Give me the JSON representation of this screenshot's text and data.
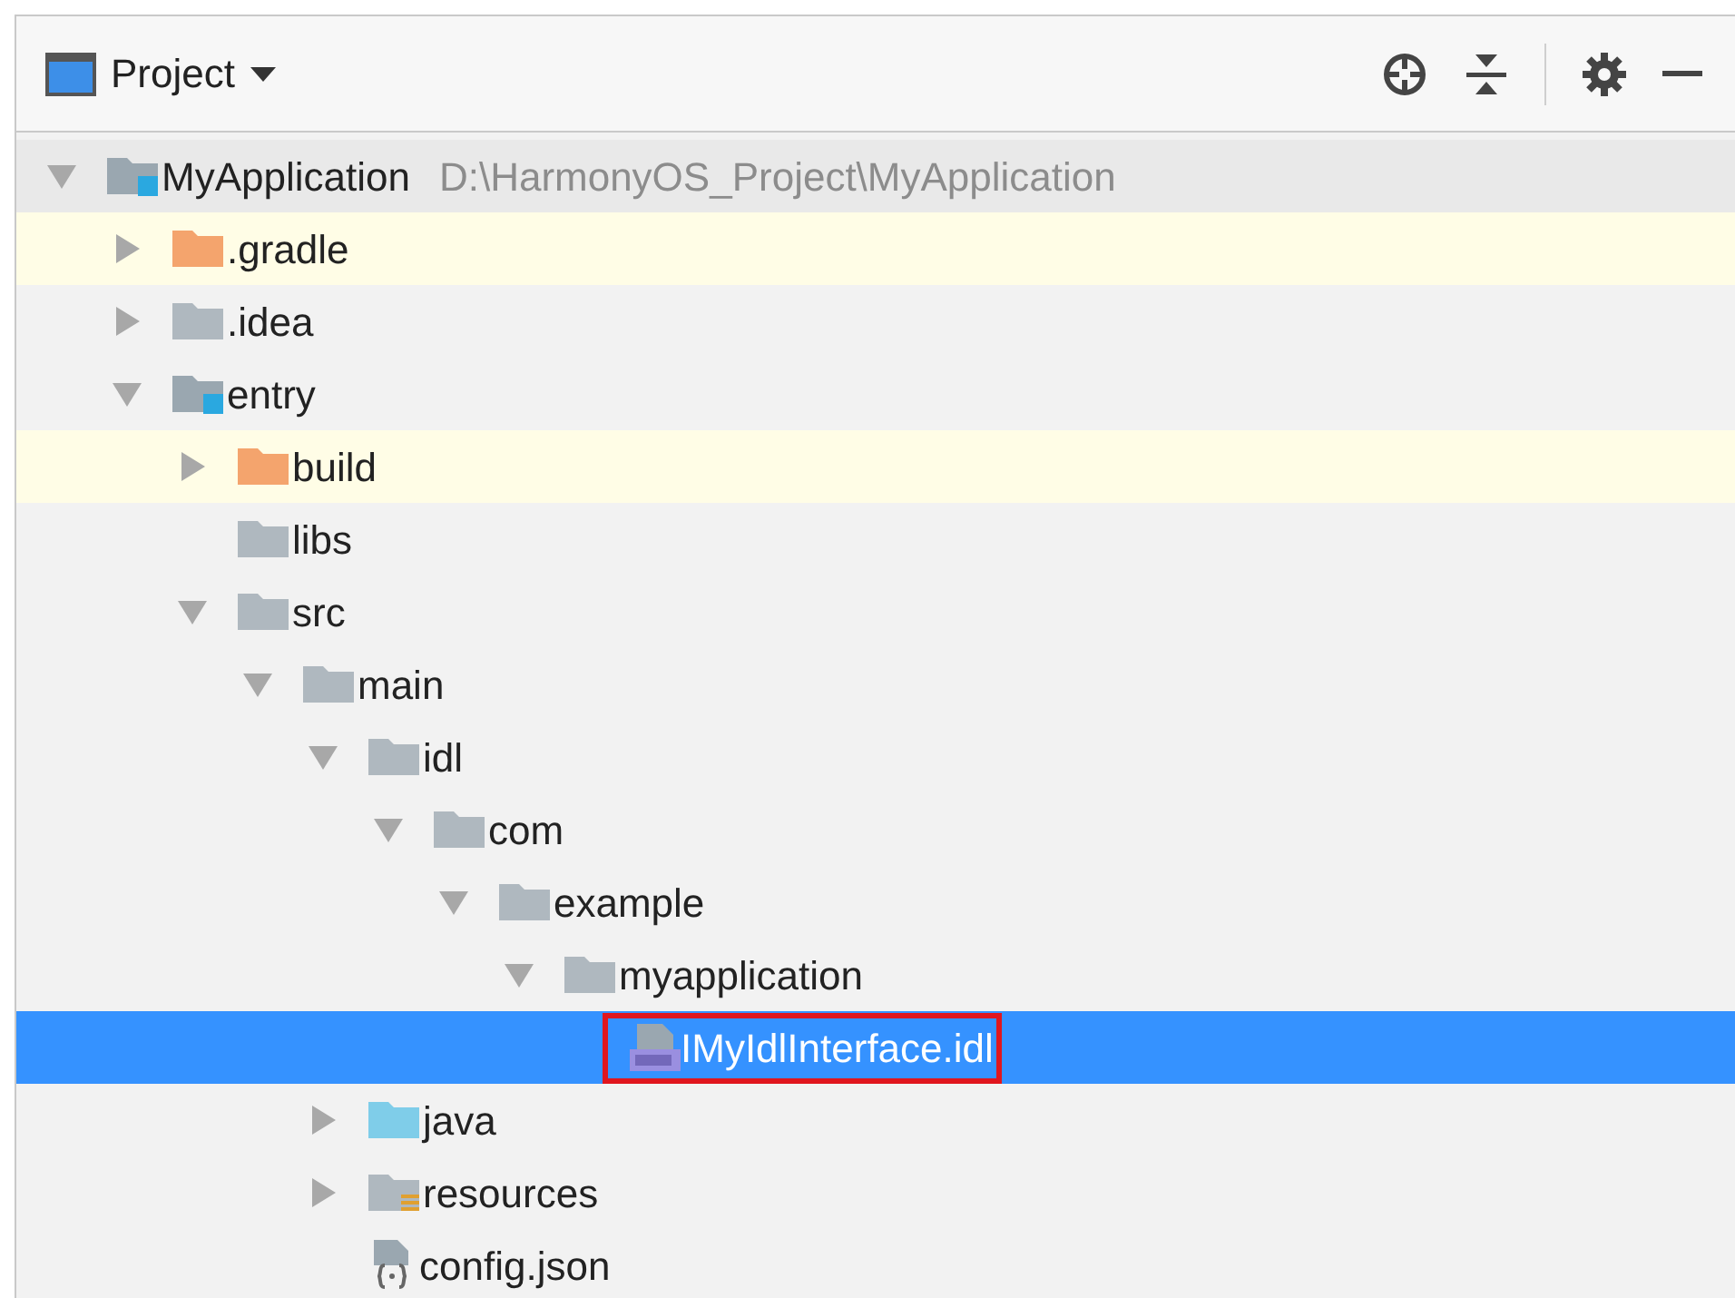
{
  "header": {
    "title": "Project"
  },
  "tree": [
    {
      "label": "MyApplication",
      "path": "D:\\HarmonyOS_Project\\MyApplication",
      "kind": "module",
      "expanded": true,
      "selected": false,
      "outlined": false,
      "children": [
        {
          "label": ".gradle",
          "kind": "excluded",
          "expanded": false,
          "selected": false,
          "outlined": false
        },
        {
          "label": ".idea",
          "kind": "folder",
          "expanded": false,
          "selected": false,
          "outlined": false
        },
        {
          "label": "entry",
          "kind": "module",
          "expanded": true,
          "selected": false,
          "outlined": false,
          "children": [
            {
              "label": "build",
              "kind": "excluded",
              "expanded": false,
              "selected": false,
              "outlined": false
            },
            {
              "label": "libs",
              "kind": "folder",
              "selected": false,
              "outlined": false
            },
            {
              "label": "src",
              "kind": "folder",
              "expanded": true,
              "selected": false,
              "outlined": false,
              "children": [
                {
                  "label": "main",
                  "kind": "folder",
                  "expanded": true,
                  "selected": false,
                  "outlined": false,
                  "children": [
                    {
                      "label": "idl",
                      "kind": "folder",
                      "expanded": true,
                      "selected": false,
                      "outlined": false,
                      "children": [
                        {
                          "label": "com",
                          "kind": "folder",
                          "expanded": true,
                          "selected": false,
                          "outlined": false,
                          "children": [
                            {
                              "label": "example",
                              "kind": "folder",
                              "expanded": true,
                              "selected": false,
                              "outlined": false,
                              "children": [
                                {
                                  "label": "myapplication",
                                  "kind": "folder",
                                  "expanded": true,
                                  "selected": false,
                                  "outlined": false,
                                  "children": [
                                    {
                                      "label": "IMyIdlInterface.idl",
                                      "kind": "idl",
                                      "selected": true,
                                      "outlined": true
                                    }
                                  ]
                                }
                              ]
                            }
                          ]
                        }
                      ]
                    },
                    {
                      "label": "java",
                      "kind": "source",
                      "expanded": false,
                      "selected": false,
                      "outlined": false
                    },
                    {
                      "label": "resources",
                      "kind": "resources",
                      "expanded": false,
                      "selected": false,
                      "outlined": false
                    },
                    {
                      "label": "config.json",
                      "kind": "json",
                      "selected": false,
                      "outlined": false
                    }
                  ]
                }
              ]
            }
          ]
        }
      ]
    }
  ]
}
